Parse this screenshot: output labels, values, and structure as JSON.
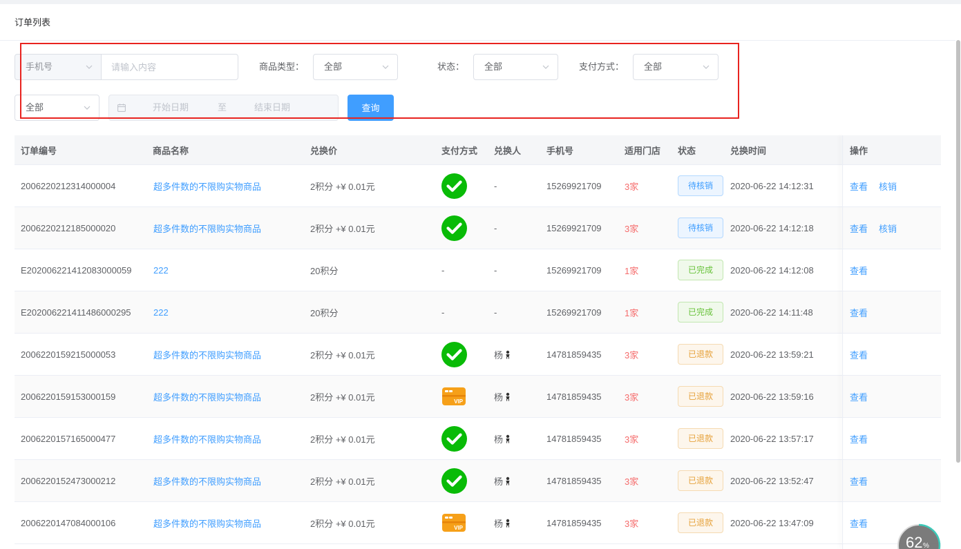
{
  "page": {
    "title": "订单列表"
  },
  "filters": {
    "search_type": {
      "value": "手机号"
    },
    "search_input": {
      "placeholder": "请输入内容"
    },
    "product_type": {
      "label": "商品类型：",
      "value": "全部"
    },
    "status": {
      "label": "状态：",
      "value": "全部"
    },
    "payment_method": {
      "label": "支付方式：",
      "value": "全部"
    },
    "extra_select": {
      "value": "全部"
    },
    "date_range": {
      "start_placeholder": "开始日期",
      "separator": "至",
      "end_placeholder": "结束日期"
    },
    "query_button": {
      "label": "查询"
    }
  },
  "table": {
    "columns": [
      "订单编号",
      "商品名称",
      "兑换价",
      "支付方式",
      "兑换人",
      "手机号",
      "适用门店",
      "状态",
      "兑换时间",
      "操作"
    ],
    "rows": [
      {
        "order_no": "2006220212314000004",
        "product": "超多件数的不限购实物商品",
        "price": "2积分 +¥ 0.01元",
        "payment_icon": "wechat-pay-icon",
        "redeemer": "-",
        "phone": "15269921709",
        "stores": "3家",
        "status": "待核销",
        "time": "2020-06-22 14:12:31",
        "actions": [
          "查看",
          "核销"
        ]
      },
      {
        "order_no": "2006220212185000020",
        "product": "超多件数的不限购实物商品",
        "price": "2积分 +¥ 0.01元",
        "payment_icon": "wechat-pay-icon",
        "redeemer": "-",
        "phone": "15269921709",
        "stores": "3家",
        "status": "待核销",
        "time": "2020-06-22 14:12:18",
        "actions": [
          "查看",
          "核销"
        ]
      },
      {
        "order_no": "E202006221412083000059",
        "product": "222",
        "price": "20积分",
        "payment_text": "-",
        "redeemer": "-",
        "phone": "15269921709",
        "stores": "1家",
        "status": "已完成",
        "time": "2020-06-22 14:12:08",
        "actions": [
          "查看"
        ]
      },
      {
        "order_no": "E202006221411486000295",
        "product": "222",
        "price": "20积分",
        "payment_text": "-",
        "redeemer": "-",
        "phone": "15269921709",
        "stores": "1家",
        "status": "已完成",
        "time": "2020-06-22 14:11:48",
        "actions": [
          "查看"
        ]
      },
      {
        "order_no": "2006220159215000053",
        "product": "超多件数的不限购实物商品",
        "price": "2积分 +¥ 0.01元",
        "payment_icon": "wechat-pay-icon",
        "redeemer": "杨",
        "redeemer_emoji": "small-figure-emoji-icon",
        "phone": "14781859435",
        "stores": "3家",
        "status": "已退款",
        "time": "2020-06-22 13:59:21",
        "actions": [
          "查看"
        ]
      },
      {
        "order_no": "2006220159153000159",
        "product": "超多件数的不限购实物商品",
        "price": "2积分 +¥ 0.01元",
        "payment_icon": "vip-card-icon",
        "redeemer": "杨",
        "redeemer_emoji": "small-figure-emoji-icon",
        "phone": "14781859435",
        "stores": "3家",
        "status": "已退款",
        "time": "2020-06-22 13:59:16",
        "actions": [
          "查看"
        ]
      },
      {
        "order_no": "2006220157165000477",
        "product": "超多件数的不限购实物商品",
        "price": "2积分 +¥ 0.01元",
        "payment_icon": "wechat-pay-icon",
        "redeemer": "杨",
        "redeemer_emoji": "small-figure-emoji-icon",
        "phone": "14781859435",
        "stores": "3家",
        "status": "已退款",
        "time": "2020-06-22 13:57:17",
        "actions": [
          "查看"
        ]
      },
      {
        "order_no": "2006220152473000212",
        "product": "超多件数的不限购实物商品",
        "price": "2积分 +¥ 0.01元",
        "payment_icon": "wechat-pay-icon",
        "redeemer": "杨",
        "redeemer_emoji": "small-figure-emoji-icon",
        "phone": "14781859435",
        "stores": "3家",
        "status": "已退款",
        "time": "2020-06-22 13:52:47",
        "actions": [
          "查看"
        ]
      },
      {
        "order_no": "2006220147084000106",
        "product": "超多件数的不限购实物商品",
        "price": "2积分 +¥ 0.01元",
        "payment_icon": "vip-card-icon",
        "redeemer": "杨",
        "redeemer_emoji": "small-figure-emoji-icon",
        "phone": "14781859435",
        "stores": "3家",
        "status": "已退款",
        "time": "2020-06-22 13:47:09",
        "actions": [
          "查看"
        ]
      }
    ]
  },
  "payment_icons": {
    "vip_card_text": "VIP"
  },
  "perf_badge": {
    "value": 62,
    "unit": "%"
  },
  "colors": {
    "primary": "#409eff",
    "danger": "#f56c6c",
    "wechat_green": "#09bb07",
    "vip_orange": "#f6a019",
    "annotation_red": "#e8231f",
    "perf_arc": "#3cc9b8",
    "status_tags": {
      "待核销": {
        "text": "#409eff",
        "bg": "#ecf5ff",
        "border": "#b3d8ff"
      },
      "已完成": {
        "text": "#67c23a",
        "bg": "#f0f9eb",
        "border": "#c2e7b0"
      },
      "已退款": {
        "text": "#e6a23c",
        "bg": "#fdf6ec",
        "border": "#f5dab1"
      }
    }
  }
}
